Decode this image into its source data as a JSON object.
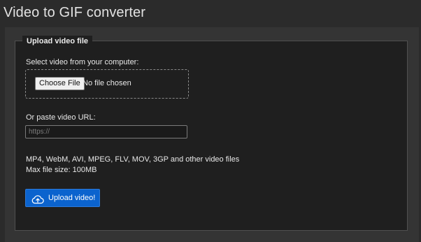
{
  "page": {
    "title": "Video to GIF converter"
  },
  "upload_form": {
    "legend": "Upload video file",
    "select_label": "Select video from your computer:",
    "choose_button": "Choose File",
    "file_status": "No file chosen",
    "url_label": "Or paste video URL:",
    "url_placeholder": "https://",
    "url_value": "",
    "formats_line": "MP4, WebM, AVI, MPEG, FLV, MOV, 3GP and other video files",
    "max_size_line": "Max file size: 100MB",
    "upload_button": "Upload video!",
    "upload_icon": "cloud-upload-icon"
  },
  "colors": {
    "background": "#2b2b2b",
    "panel": "#343434",
    "fieldset": "#1f1f1f",
    "accent_button": "#0b63ce"
  }
}
